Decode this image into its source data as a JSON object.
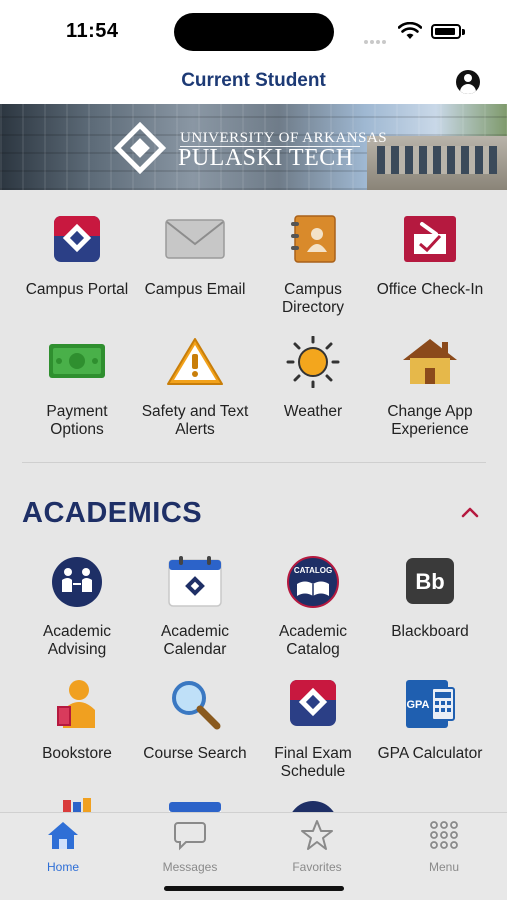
{
  "status": {
    "time": "11:54"
  },
  "header": {
    "title": "Current Student"
  },
  "banner": {
    "line1": "UNIVERSITY OF ARKANSAS",
    "line2": "PULASKI TECH"
  },
  "quick_links": [
    {
      "label": "Campus Portal",
      "icon": "campus-portal-icon"
    },
    {
      "label": "Campus Email",
      "icon": "envelope-icon"
    },
    {
      "label": "Campus Directory",
      "icon": "directory-book-icon"
    },
    {
      "label": "Office Check-In",
      "icon": "check-in-icon"
    },
    {
      "label": "Payment Options",
      "icon": "money-icon"
    },
    {
      "label": "Safety and Text Alerts",
      "icon": "warning-icon"
    },
    {
      "label": "Weather",
      "icon": "sun-icon"
    },
    {
      "label": "Change App Experience",
      "icon": "house-icon"
    }
  ],
  "academics": {
    "title": "ACADEMICS",
    "items": [
      {
        "label": "Academic Advising",
        "icon": "advising-icon"
      },
      {
        "label": "Academic Calendar",
        "icon": "calendar-icon"
      },
      {
        "label": "Academic Catalog",
        "icon": "catalog-icon"
      },
      {
        "label": "Blackboard",
        "icon": "blackboard-icon"
      },
      {
        "label": "Bookstore",
        "icon": "bookstore-icon"
      },
      {
        "label": "Course Search",
        "icon": "magnifier-icon"
      },
      {
        "label": "Final Exam Schedule",
        "icon": "exam-schedule-icon"
      },
      {
        "label": "GPA Calculator",
        "icon": "gpa-calculator-icon"
      }
    ]
  },
  "tabbar": {
    "tabs": [
      {
        "label": "Home",
        "icon": "home-icon",
        "active": true
      },
      {
        "label": "Messages",
        "icon": "chat-bubble-icon"
      },
      {
        "label": "Favorites",
        "icon": "star-icon"
      },
      {
        "label": "Menu",
        "icon": "grid-icon"
      }
    ]
  },
  "colors": {
    "brand": "#1e2f66",
    "accent_red": "#b5193f",
    "tab_active": "#2f6fd6",
    "tab_inactive": "#8a8a8a"
  }
}
